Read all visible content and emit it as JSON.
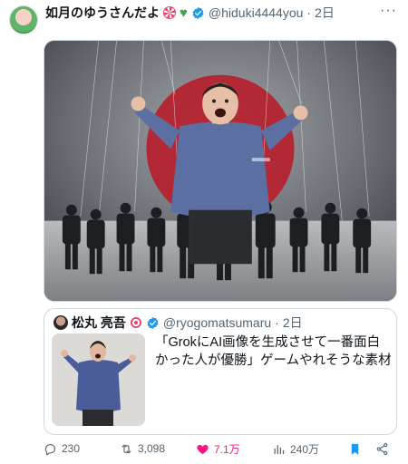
{
  "post": {
    "author": {
      "display_name": "如月のゆうさんだよ",
      "handle": "@hiduki4444you",
      "separator": "·",
      "time": "2日",
      "verified": true
    },
    "more_icon": "more-horizontal-icon",
    "media": {
      "kind": "image"
    },
    "quote": {
      "author": {
        "display_name": "松丸 亮吾",
        "handle": "@ryogomatsumaru",
        "separator": "·",
        "time": "2日",
        "verified": true
      },
      "text": "「GrokにAI画像を生成させて一番面白かった人が優勝」ゲームやれそうな素材"
    },
    "actions": {
      "replies": "230",
      "reposts": "3,098",
      "likes": "7.1万",
      "views": "240万"
    },
    "colors": {
      "like": "#f91880",
      "bookmark": "#1d9bf0",
      "verified": "#1d9bf0",
      "muted": "#536471"
    }
  }
}
